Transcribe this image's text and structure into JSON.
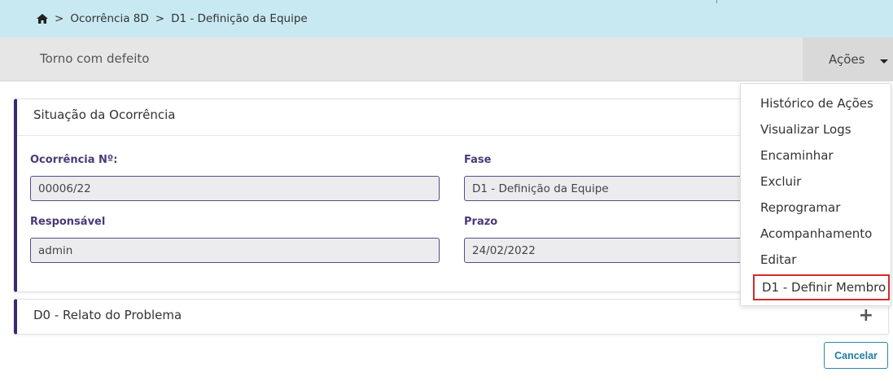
{
  "breadcrumb": {
    "items": [
      "Ocorrência 8D",
      "D1 - Definição da Equipe"
    ],
    "separator": ">"
  },
  "subheader": {
    "title": "Torno com defeito",
    "actions_label": "Ações"
  },
  "situacao": {
    "title": "Situação da Ocorrência",
    "fields": {
      "ocorrencia_label": "Ocorrência Nº:",
      "ocorrencia_value": "00006/22",
      "fase_label": "Fase",
      "fase_value": "D1 - Definição da Equipe",
      "responsavel_label": "Responsável",
      "responsavel_value": "admin",
      "prazo_label": "Prazo",
      "prazo_value": "24/02/2022"
    }
  },
  "d0": {
    "title": "D0 - Relato do Problema",
    "expand_symbol": "+"
  },
  "footer": {
    "cancel_label": "Cancelar"
  },
  "actions_menu": {
    "items": [
      "Histórico de Ações",
      "Visualizar Logs",
      "Encaminhar",
      "Excluir",
      "Reprogramar",
      "Acompanhamento",
      "Editar",
      "D1 - Definir Membro"
    ]
  },
  "colors": {
    "breadcrumb_bg": "#c9e9f2",
    "accent": "#3b2a6b",
    "highlight_border": "#d42a2a",
    "cancel": "#1f7fa0"
  },
  "icons": {
    "home": "home-icon",
    "actions_caret": "caret-down-icon",
    "expand": "plus-icon"
  }
}
